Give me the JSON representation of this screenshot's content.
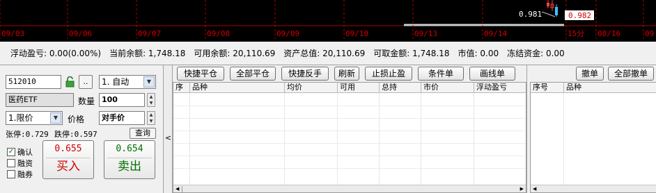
{
  "chart": {
    "price_labels": {
      "low": "0.981",
      "current": "0.982"
    },
    "dates": [
      "09/03",
      "09/06",
      "09/07",
      "09/08",
      "09/09",
      "09/10",
      "09/13",
      "09/14",
      "15分",
      "08/16",
      "09"
    ]
  },
  "summary": [
    "浮动盈亏: 0.00(0.00%)",
    "当前余额: 1,748.18",
    "可用余额: 20,110.69",
    "资产总值: 20,110.69",
    "可取金额: 1,748.18",
    "市值: 0.00",
    "冻结资金: 0.00"
  ],
  "order": {
    "code": "512010",
    "more_label": "..",
    "mode": "1. 自动",
    "name": "医药ETF",
    "qty_label": "数量",
    "qty": "100",
    "price_type": "1.限价",
    "price_label": "价格",
    "price_mode": "对手价",
    "limit_up": "张停:0.729",
    "limit_down": "跌停:0.597",
    "query": "查询",
    "confirm": "确认",
    "margin": "融资",
    "short": "融券",
    "buy_price": "0.655",
    "buy_label": "买入",
    "sell_price": "0.654",
    "sell_label": "卖出"
  },
  "positions": {
    "toolbar": [
      "快捷平仓",
      "全部平仓",
      "快捷反手",
      "刷新",
      "止损止盈",
      "条件单",
      "画线单"
    ],
    "columns": [
      "序",
      "品种",
      "均价",
      "可用",
      "总持",
      "市价",
      "浮动盈亏"
    ]
  },
  "orders": {
    "toolbar": [
      "撤单",
      "全部撤单"
    ],
    "columns": [
      "序号",
      "品种"
    ]
  },
  "colors": {
    "buy": "#d00000",
    "sell": "#007000",
    "grid_red": "#b00000"
  }
}
